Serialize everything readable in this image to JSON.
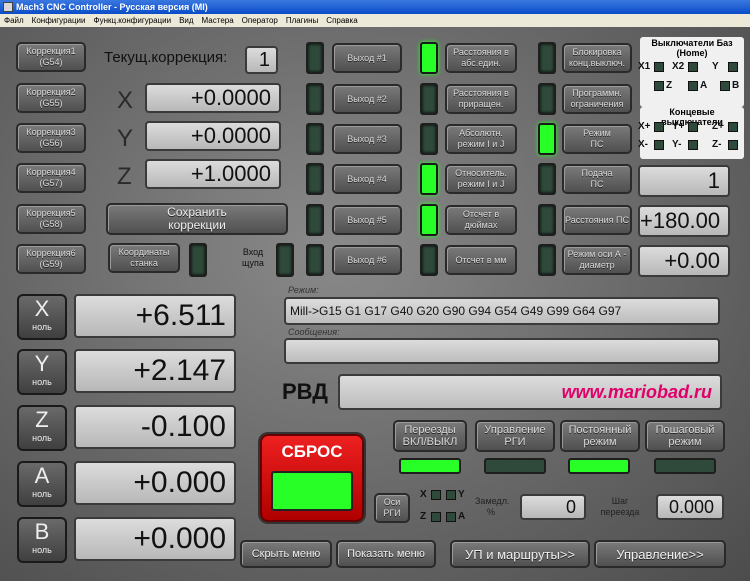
{
  "window": {
    "title": "Mach3 CNC Controller - Русская версия (MI)"
  },
  "menu": [
    "Файл",
    "Конфигурации",
    "Функц.конфигурации",
    "Вид",
    "Мастера",
    "Оператор",
    "Плагины",
    "Справка"
  ],
  "offsets": [
    {
      "l1": "Коррекция1",
      "l2": "(G54)"
    },
    {
      "l1": "Коррекция2",
      "l2": "(G55)"
    },
    {
      "l1": "Коррекция3",
      "l2": "(G56)"
    },
    {
      "l1": "Коррекция4",
      "l2": "(G57)"
    },
    {
      "l1": "Коррекция5",
      "l2": "(G58)"
    },
    {
      "l1": "Коррекция6",
      "l2": "(G59)"
    }
  ],
  "current_offset": {
    "label": "Текущ.коррекция:",
    "value": "1"
  },
  "offset_values": [
    {
      "axis": "X",
      "value": "+0.0000"
    },
    {
      "axis": "Y",
      "value": "+0.0000"
    },
    {
      "axis": "Z",
      "value": "+1.0000"
    }
  ],
  "save_offsets": "Сохранить коррекции",
  "machine_coords": "Координаты станка",
  "probe_input": "Вход щупа",
  "outputs": [
    {
      "label": "Выход #1",
      "led": false
    },
    {
      "label": "Выход #2",
      "led": false
    },
    {
      "label": "Выход #3",
      "led": false
    },
    {
      "label": "Выход #4",
      "led": false
    },
    {
      "label": "Выход #5",
      "led": false
    },
    {
      "label": "Выход #6",
      "led": false
    }
  ],
  "modes": [
    {
      "label": "Расстояния в абс.един.",
      "led": true
    },
    {
      "label": "Расстояния в приращен.",
      "led": false
    },
    {
      "label": "Абсолютн. режим I и J",
      "led": false
    },
    {
      "label": "Относитель. режим I и J",
      "led": true
    },
    {
      "label": "Отсчет в дюймах",
      "led": true
    },
    {
      "label": "Отсчет в мм",
      "led": false
    }
  ],
  "right_buttons": [
    {
      "label": "Блокировка конц.выключ.",
      "led": false
    },
    {
      "label": "Программн. ограничения",
      "led": false
    },
    {
      "label": "Режим ПС",
      "led": true
    },
    {
      "label": "Подача ПС",
      "led": false
    },
    {
      "label": "Расстояния ПС",
      "led": false
    },
    {
      "label": "Режим оси А - диаметр",
      "led": false
    }
  ],
  "home_switches": {
    "title": "Выключатели Баз (Home)",
    "axes": [
      "X1",
      "X2",
      "Y",
      "Z",
      "A",
      "B"
    ]
  },
  "limit_switches": {
    "title": "Концевые выключатели",
    "axes": [
      "X+",
      "Y+",
      "Z+",
      "X-",
      "Y-",
      "Z-"
    ]
  },
  "right_values": [
    "1",
    "+180.00",
    "+0.00"
  ],
  "dro": [
    {
      "axis": "X",
      "sub": "ноль",
      "value": "+6.511"
    },
    {
      "axis": "Y",
      "sub": "ноль",
      "value": "+2.147"
    },
    {
      "axis": "Z",
      "sub": "ноль",
      "value": "-0.100"
    },
    {
      "axis": "A",
      "sub": "ноль",
      "value": "+0.000"
    },
    {
      "axis": "B",
      "sub": "ноль",
      "value": "+0.000"
    }
  ],
  "modal": {
    "label": "Режим:",
    "value": "Mill->G15  G1 G17 G40 G20 G90 G94 G54 G49 G99 G64 G97"
  },
  "messages": {
    "label": "Сообщения:",
    "value": ""
  },
  "rvd": {
    "label": "РВД",
    "value": "www.mariobad.ru"
  },
  "reset": "СБРОС",
  "jog_buttons": [
    {
      "label": "Переезды ВКЛ/ВЫКЛ",
      "led": true
    },
    {
      "label": "Управление РГИ",
      "led": false
    },
    {
      "label": "Постоянный режим",
      "led": true
    },
    {
      "label": "Пошаговый режим",
      "led": false
    }
  ],
  "axes_rgi": "Оси РГИ",
  "rgi_axes": [
    "X",
    "Y",
    "Z",
    "A"
  ],
  "slow": {
    "label": "Замедл. %",
    "value": "0"
  },
  "step": {
    "label": "Шаг переезда",
    "value": "0.000"
  },
  "bottom_buttons": [
    "Скрыть меню",
    "Показать меню",
    "УП и маршруты>>",
    "Управление>>"
  ]
}
